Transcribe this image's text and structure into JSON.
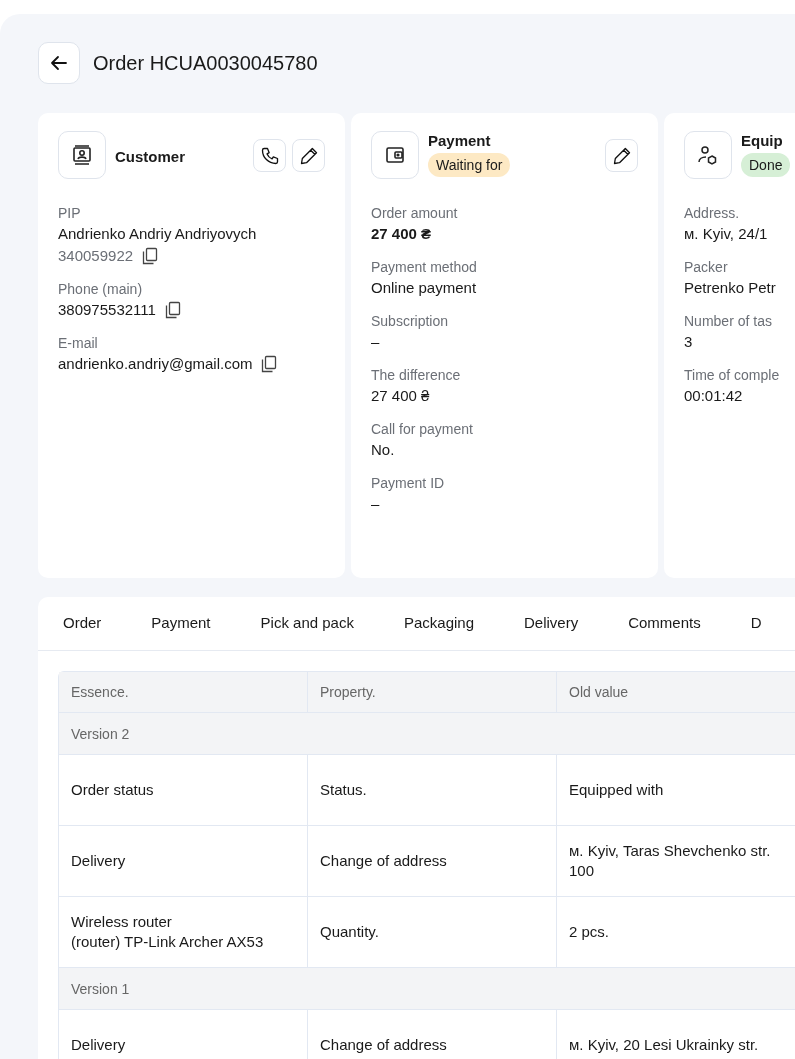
{
  "header": {
    "title": "Order HCUA0030045780"
  },
  "cards": [
    {
      "kind": "customer",
      "title": "Customer",
      "actions": [
        {
          "kind": "call"
        },
        {
          "kind": "edit"
        }
      ],
      "fields": [
        {
          "label": "PIP",
          "values": [
            {
              "text": "Andrienko Andriy Andriyovych",
              "kind": "plain"
            },
            {
              "text": "340059922",
              "kind": "muted-copy"
            }
          ]
        },
        {
          "label": "Phone (main)",
          "values": [
            {
              "text": "380975532111",
              "kind": "copy"
            }
          ]
        },
        {
          "label": "E-mail",
          "values": [
            {
              "text": "andrienko.andriy@gmail.com",
              "kind": "copy"
            }
          ]
        }
      ]
    },
    {
      "kind": "payment",
      "title": "Payment",
      "status": {
        "text": "Waiting for",
        "color": "#fde9c4"
      },
      "actions": [
        {
          "kind": "edit"
        }
      ],
      "fields": [
        {
          "label": "Order amount",
          "values": [
            {
              "text": "27 400 ₴",
              "kind": "amount"
            }
          ]
        },
        {
          "label": "Payment method",
          "values": [
            {
              "text": "Online payment",
              "kind": "plain"
            }
          ]
        },
        {
          "label": "Subscription",
          "values": [
            {
              "text": "–",
              "kind": "plain"
            }
          ]
        },
        {
          "label": "The difference",
          "values": [
            {
              "text": "27 400 ₴",
              "kind": "plain"
            }
          ]
        },
        {
          "label": "Call for payment",
          "values": [
            {
              "text": "No.",
              "kind": "plain"
            }
          ]
        },
        {
          "label": "Payment ID",
          "values": [
            {
              "text": "–",
              "kind": "plain"
            }
          ]
        }
      ]
    },
    {
      "kind": "equipment",
      "title": "Equip",
      "status": {
        "text": "Done",
        "color": "#d6efd6"
      },
      "fields": [
        {
          "label": "Address.",
          "values": [
            {
              "text": "м. Kyiv, 24/1",
              "kind": "plain"
            }
          ]
        },
        {
          "label": "Packer",
          "values": [
            {
              "text": "Petrenko Petr",
              "kind": "plain"
            }
          ]
        },
        {
          "label": "Number of tas",
          "values": [
            {
              "text": "3",
              "kind": "plain"
            }
          ]
        },
        {
          "label": "Time of comple",
          "values": [
            {
              "text": "00:01:42",
              "kind": "plain"
            }
          ]
        }
      ]
    }
  ],
  "tabs": [
    {
      "label": "Order",
      "selected": false
    },
    {
      "label": "Payment",
      "selected": false
    },
    {
      "label": "Pick and pack",
      "selected": false
    },
    {
      "label": "Packaging",
      "selected": false
    },
    {
      "label": "Delivery",
      "selected": false
    },
    {
      "label": "Comments",
      "selected": false
    },
    {
      "label": "D",
      "selected": false
    }
  ],
  "table": {
    "columns": [
      "Essence.",
      "Property.",
      "Old value"
    ],
    "groups": [
      {
        "title": "Version 2",
        "rows": [
          [
            "Order status",
            "Status.",
            "Equipped with"
          ],
          [
            "Delivery",
            "Change of address",
            "м. Kyiv, Taras Shevchenko str. 100"
          ],
          [
            "Wireless router\n(router) TP-Link Archer AX53",
            "Quantity.",
            "2 pcs."
          ]
        ]
      },
      {
        "title": "Version 1",
        "rows": [
          [
            "Delivery",
            "Change of address",
            "м. Kyiv, 20 Lesi Ukrainky str."
          ]
        ]
      }
    ]
  }
}
